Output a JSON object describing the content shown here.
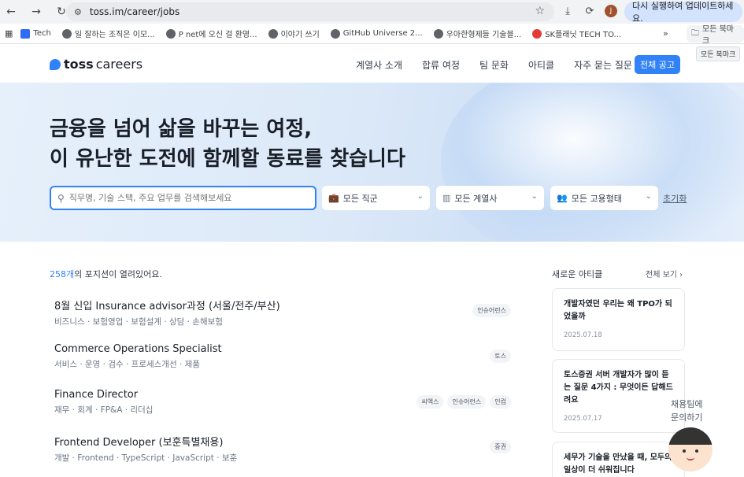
{
  "browser": {
    "url": "toss.im/career/jobs",
    "update_label": "다시 실행하여 업데이트하세요.",
    "avatar_letter": "J",
    "bookmarks": [
      "Tech",
      "일 잘하는 조직은 이모...",
      "P net에 오신 걸 환영...",
      "이야기 쓰기",
      "GitHub Universe 2...",
      "우아한형제들 기술블...",
      "SK플래닛 TECH TO..."
    ],
    "more_label": "»",
    "folder_label": "모든 북마크",
    "tooltip": "모든 북마크"
  },
  "header": {
    "logo_bold": "toss",
    "logo_light": "careers",
    "nav": [
      "계열사 소개",
      "합류 여정",
      "팀 문화",
      "아티클",
      "자주 묻는 질문"
    ],
    "cta": "전체 공고"
  },
  "hero": {
    "title_line1": "금융을 넘어 삶을 바꾸는 여정,",
    "title_line2": "이 유난한 도전에 함께할 동료를 찾습니다",
    "search_placeholder": "직무명, 기술 스택, 주요 업무를 검색해보세요",
    "filters": [
      "모든 직군",
      "모든 계열사",
      "모든 고용형태"
    ],
    "reset": "초기화"
  },
  "listing": {
    "count_number": "258개",
    "count_suffix": "의 포지션이 열려있어요.",
    "jobs": [
      {
        "title": "8월 신입 Insurance advisor과정 (서울/전주/부산)",
        "tags": "비즈니스 · 보험영업 · 보험설계 · 상담 · 손해보험",
        "badges": [
          "인슈어런스"
        ]
      },
      {
        "title": "Commerce Operations Specialist",
        "tags": "서비스 · 운영 · 검수 · 프로세스개선 · 제품",
        "badges": [
          "토스"
        ]
      },
      {
        "title": "Finance Director",
        "tags": "재무 · 회계 · FP&A · 리더십",
        "badges": [
          "씨엑스",
          "인슈어런스",
          "인컴"
        ]
      },
      {
        "title": "Frontend Developer (보훈특별채용)",
        "tags": "개발 · Frontend · TypeScript · JavaScript · 보훈",
        "badges": [
          "증권"
        ]
      }
    ]
  },
  "sidebar": {
    "title": "새로운 아티클",
    "more": "전체 보기 ›",
    "articles": [
      {
        "title": "개발자였던 우리는 왜 TPO가 되었을까",
        "date": "2025.07.18"
      },
      {
        "title": "토스증권 서버 개발자가 많이 듣는 질문 4가지 : 무엇이든 답해드려요",
        "date": "2025.07.17"
      },
      {
        "title": "세무가 기술을 만났을 때, 모두의 일상이 더 쉬워집니다",
        "date": ""
      }
    ]
  },
  "chat": {
    "line1": "채용팀에",
    "line2": "문의하기"
  }
}
